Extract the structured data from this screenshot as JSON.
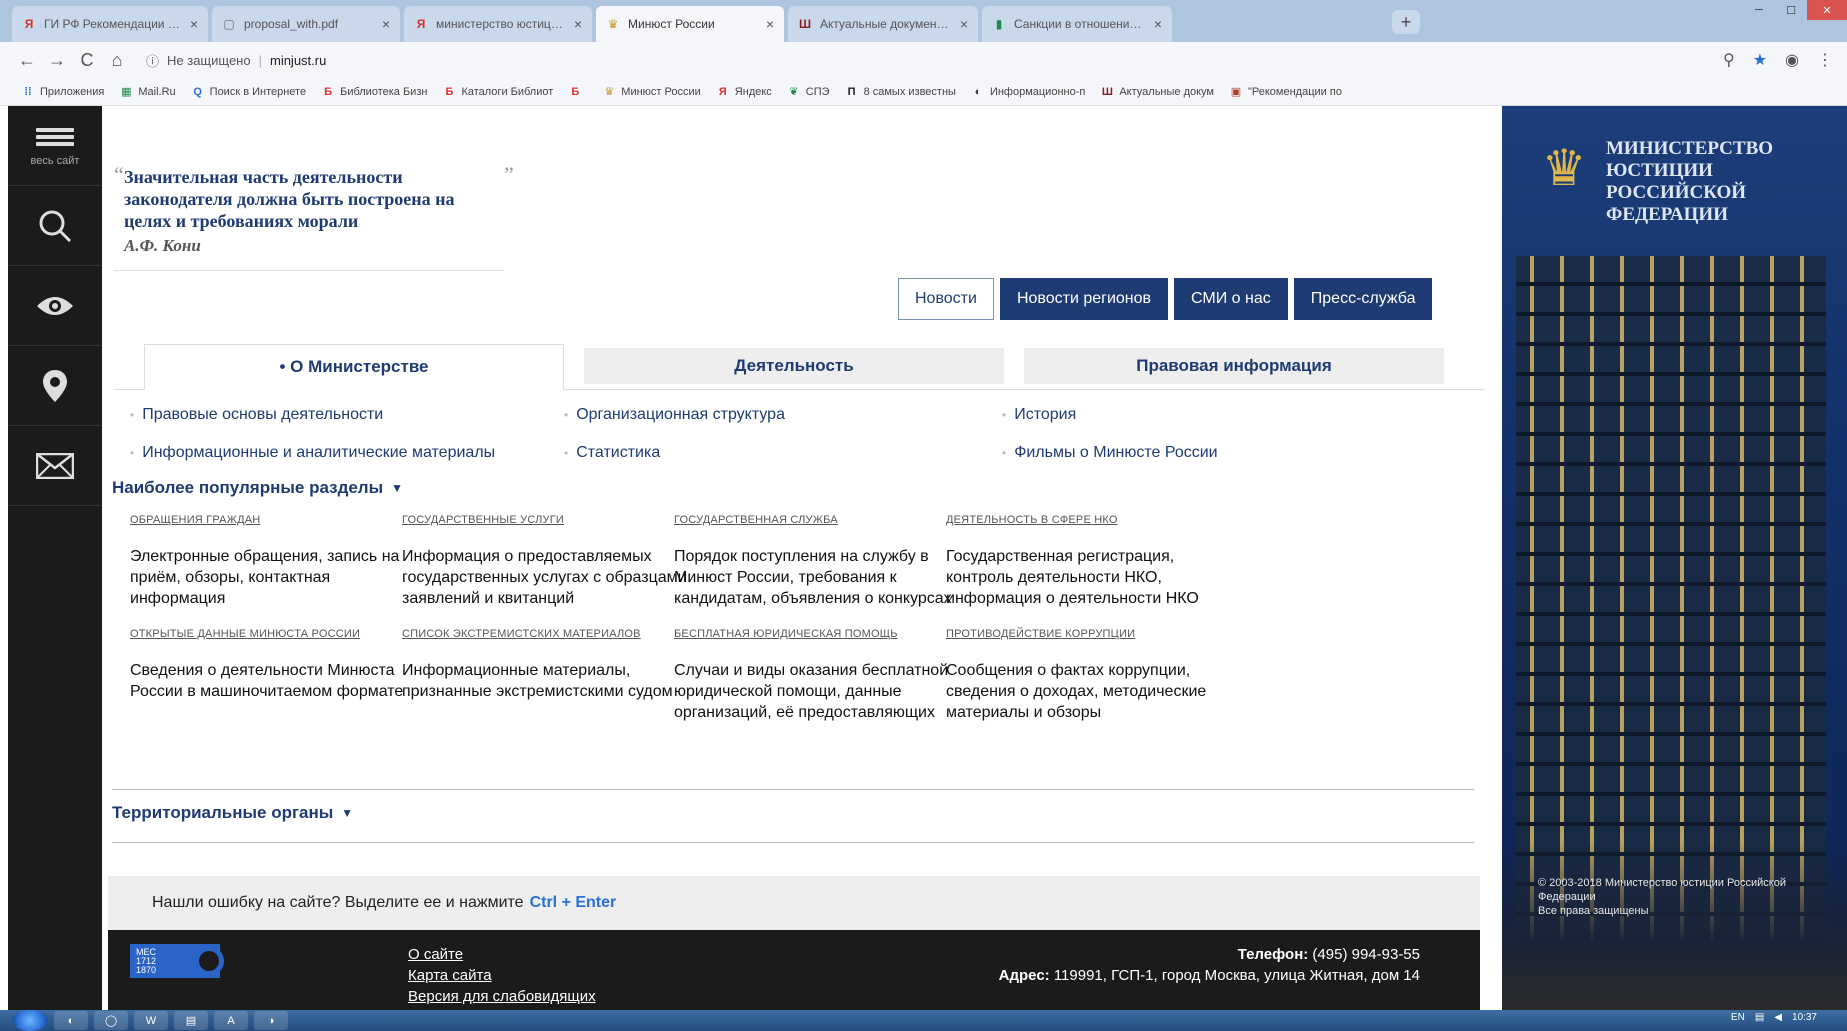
{
  "browser": {
    "tabs": [
      {
        "title": "ГИ РФ Рекомендации по работе",
        "icon": "yandex-icon",
        "favicon_glyph": "Я",
        "favicon_color": "#d9342b",
        "active": false
      },
      {
        "title": "proposal_with.pdf",
        "icon": "document-icon",
        "favicon_glyph": "▢",
        "favicon_color": "#666666",
        "active": false
      },
      {
        "title": "министерство юстиции рф сайт",
        "icon": "yandex-icon",
        "favicon_glyph": "Я",
        "favicon_color": "#d9342b",
        "active": false
      },
      {
        "title": "Минюст России",
        "icon": "emblem-icon",
        "favicon_glyph": "♛",
        "favicon_color": "#c99a2e",
        "active": true
      },
      {
        "title": "Актуальные документы | Цен",
        "icon": "book-icon",
        "favicon_glyph": "Ш",
        "favicon_color": "#8b1c1c",
        "active": false
      },
      {
        "title": "Санкции в отношении сотрудн",
        "icon": "bookmark-icon",
        "favicon_glyph": "▮",
        "favicon_color": "#1e8a4a",
        "active": false
      }
    ],
    "new_tab_label": "+",
    "close_label": "×",
    "window_controls": {
      "minimize": "─",
      "maximize": "☐",
      "close": "✕"
    },
    "nav": {
      "back": "←",
      "forward": "→",
      "reload": "C",
      "home": "⌂"
    },
    "security_icon": "ⓘ",
    "security_label": "Не защищено",
    "url": "minjust.ru",
    "addr_icons": {
      "zoom": "⚲",
      "star": "★",
      "account": "◉",
      "menu": "⋮"
    },
    "bookmarks": [
      {
        "label": "Приложения",
        "icon": "apps-icon",
        "glyph": "⁞⁞",
        "color": "#2a6fd6"
      },
      {
        "label": "Mail.Ru",
        "icon": "mailru-icon",
        "glyph": "▦",
        "color": "#1e8a4a"
      },
      {
        "label": "Поиск в Интернете",
        "icon": "search-icon",
        "glyph": "Q",
        "color": "#2a6fd6"
      },
      {
        "label": "Библиотека Бизн",
        "icon": "library-icon",
        "glyph": "Б",
        "color": "#d9342b"
      },
      {
        "label": "Каталоги Библиот",
        "icon": "library-icon",
        "glyph": "Б",
        "color": "#d9342b"
      },
      {
        "label": "",
        "icon": "library-icon",
        "glyph": "Б",
        "color": "#d9342b"
      },
      {
        "label": "Минюст России",
        "icon": "emblem-icon",
        "glyph": "♛",
        "color": "#c99a2e"
      },
      {
        "label": "Яндекс",
        "icon": "yandex-icon",
        "glyph": "Я",
        "color": "#d9342b"
      },
      {
        "label": "СПЭ",
        "icon": "leaf-icon",
        "glyph": "❦",
        "color": "#1e8a4a"
      },
      {
        "label": "8 самых известны",
        "icon": "p-icon",
        "glyph": "П",
        "color": "#222222"
      },
      {
        "label": "Информационно-п",
        "icon": "globe-icon",
        "glyph": "◐",
        "color": "#333333"
      },
      {
        "label": "Актуальные докум",
        "icon": "book-icon",
        "glyph": "Ш",
        "color": "#8b1c1c"
      },
      {
        "label": "\"Рекомендации по",
        "icon": "doc-icon",
        "glyph": "▣",
        "color": "#b23b2a"
      }
    ]
  },
  "leftbar": {
    "menu_caption": "весь сайт",
    "icons": [
      "burger-menu-icon",
      "search-icon",
      "eye-icon",
      "location-pin-icon",
      "mail-icon"
    ]
  },
  "quote": {
    "open_mark": "“",
    "close_mark": "”",
    "text": "Значительная часть деятельности законодателя должна быть построена на целях и требованиях морали",
    "author": "А.Ф. Кони"
  },
  "news_buttons": [
    "Новости",
    "Новости регионов",
    "СМИ о нас",
    "Пресс-служба"
  ],
  "main_tabs": [
    "• О Министерстве",
    "Деятельность",
    "Правовая информация"
  ],
  "sublinks": [
    "Правовые основы деятельности",
    "Организационная структура",
    "История",
    "Информационные и аналитические материалы",
    "Статистика",
    "Фильмы о Минюсте России"
  ],
  "popular": {
    "title": "Наиболее популярные разделы",
    "caret": "▼",
    "items": [
      {
        "head": "Обращения граждан",
        "desc": "Электронные обращения, запись на приём, обзоры, контактная информация"
      },
      {
        "head": "Государственные услуги",
        "desc": "Информация о предоставляемых государственных услугах с образцами заявлений и квитанций"
      },
      {
        "head": "Государственная служба",
        "desc": "Порядок поступления на службу в Минюст России, требования к кандидатам, объявления о конкурсах"
      },
      {
        "head": "Деятельность в сфере НКО",
        "desc": "Государственная регистрация, контроль деятельности НКО, информация о деятельности НКО"
      },
      {
        "head": "Открытые данные Минюста России",
        "desc": "Сведения о деятельности Минюста России в машиночитаемом формате"
      },
      {
        "head": "Список экстремистских материалов",
        "desc": "Информационные материалы, признанные экстремистскими судом"
      },
      {
        "head": "Бесплатная юридическая помощь",
        "desc": "Случаи и виды оказания бесплатной юридической помощи, данные организаций, её предоставляющих"
      },
      {
        "head": "Противодействие коррупции",
        "desc": "Сообщения о фактах коррупции, сведения о доходах, методические материалы и обзоры"
      }
    ]
  },
  "territorial": {
    "title": "Территориальные органы",
    "caret": "▼"
  },
  "error_bar": {
    "text": "Нашли ошибку на сайте? Выделите ее и нажмите",
    "keys": "Ctrl + Enter"
  },
  "footer": {
    "links": [
      "О сайте",
      "Карта сайта",
      "Версия для слабовидящих"
    ],
    "phone_label": "Телефон:",
    "phone": "(495) 994-93-55",
    "address_label": "Адрес:",
    "address": "119991, ГСП-1, город Москва, улица Житная, дом 14",
    "logo_text": "МЕС\n1712\n1870"
  },
  "right_panel": {
    "title": "Министерство юстиции Российской Федерации",
    "emblem": "♛",
    "copyright": "© 2003-2018 Министерство юстиции Российской Федерации\nВсе права защищены"
  },
  "taskbar": {
    "apps": [
      "start-icon",
      "ie-icon",
      "chrome-icon",
      "word-icon",
      "explorer-icon",
      "reader-icon",
      "chrome2-icon"
    ],
    "tray_lang": "EN",
    "clock": "10:37"
  },
  "colors": {
    "brand_blue": "#1f3b73",
    "link_blue": "#2a6fd6",
    "dark": "#1b1b1b"
  }
}
